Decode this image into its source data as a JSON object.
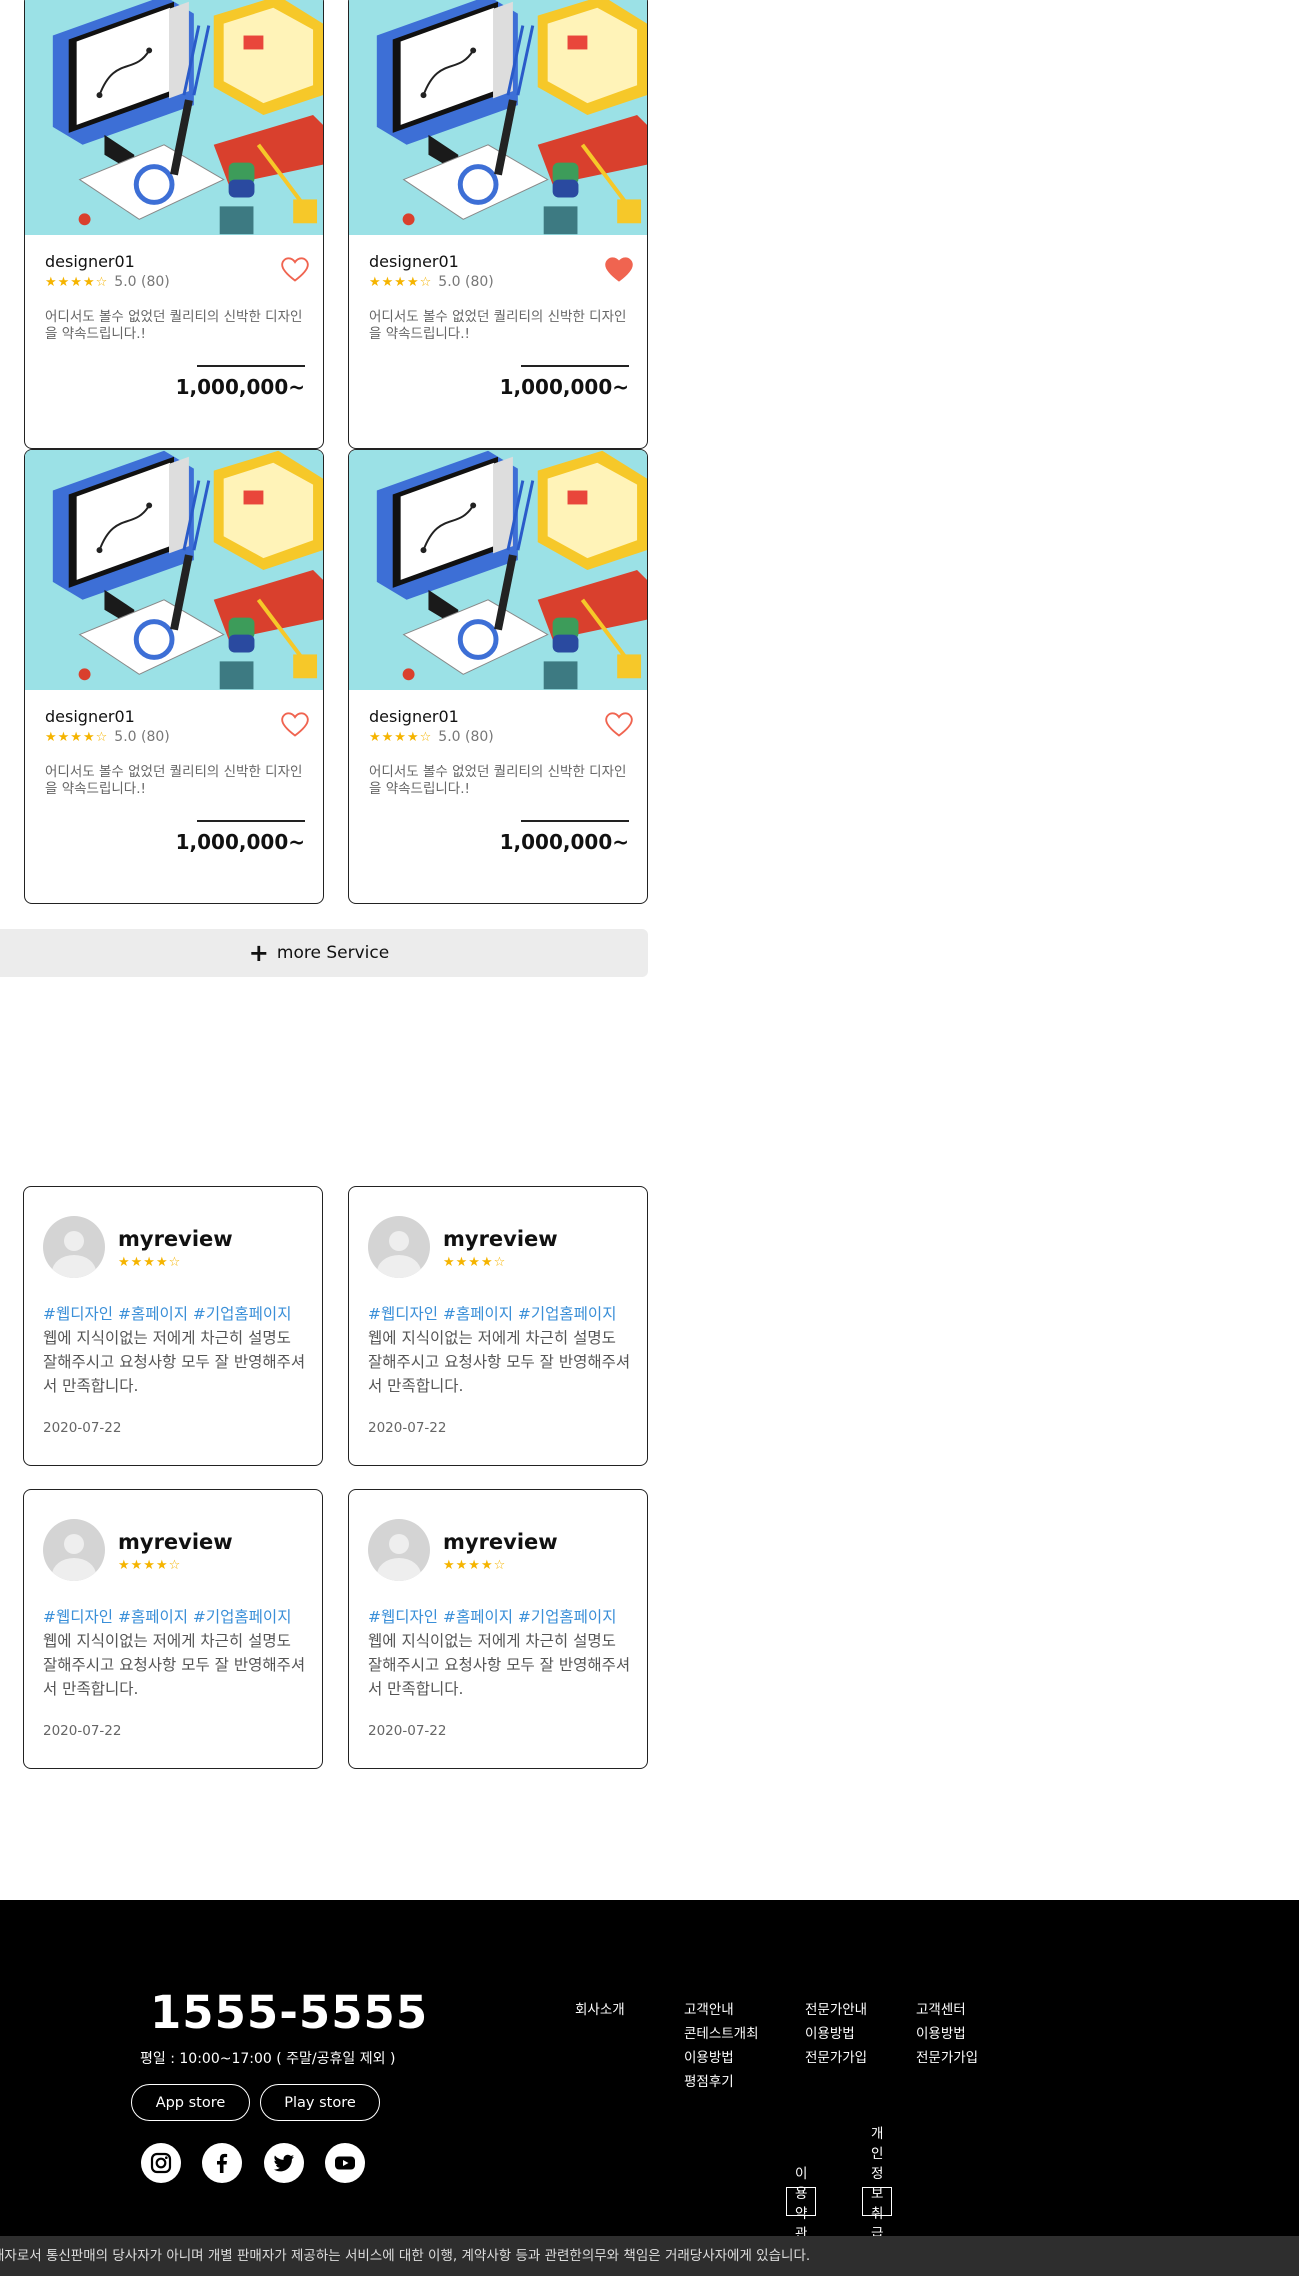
{
  "services": [
    {
      "name": "designer01",
      "stars": "★★★★☆",
      "rating": "5.0 (80)",
      "desc": "어디서도 볼수 없었던 퀄리티의 신박한 디자인을 약속드립니다.!",
      "price": "1,000,000~",
      "liked": false
    },
    {
      "name": "designer01",
      "stars": "★★★★☆",
      "rating": "5.0 (80)",
      "desc": "어디서도 볼수 없었던 퀄리티의 신박한 디자인을 약속드립니다.!",
      "price": "1,000,000~",
      "liked": true
    },
    {
      "name": "designer01",
      "stars": "★★★★☆",
      "rating": "5.0 (80)",
      "desc": "어디서도 볼수 없었던 퀄리티의 신박한 디자인을 약속드립니다.!",
      "price": "1,000,000~",
      "liked": false
    },
    {
      "name": "designer01",
      "stars": "★★★★☆",
      "rating": "5.0 (80)",
      "desc": "어디서도 볼수 없었던 퀄리티의 신박한 디자인을 약속드립니다.!",
      "price": "1,000,000~",
      "liked": false
    }
  ],
  "more_button": {
    "icon": "plus-icon",
    "label": "more Service"
  },
  "reviews": [
    {
      "name": "myreview",
      "stars": "★★★★☆",
      "tags": "#웹디자인 #홈페이지 #기업홈페이지",
      "text": "웹에 지식이없는 저에게 차근히 설명도 잘해주시고 요청사항 모두 잘 반영해주셔서 만족합니다.",
      "date": "2020-07-22"
    },
    {
      "name": "myreview",
      "stars": "★★★★☆",
      "tags": "#웹디자인 #홈페이지 #기업홈페이지",
      "text": "웹에 지식이없는 저에게 차근히 설명도 잘해주시고 요청사항 모두 잘 반영해주셔서 만족합니다.",
      "date": "2020-07-22"
    },
    {
      "name": "myreview",
      "stars": "★★★★☆",
      "tags": "#웹디자인 #홈페이지 #기업홈페이지",
      "text": "웹에 지식이없는 저에게 차근히 설명도 잘해주시고 요청사항 모두 잘 반영해주셔서 만족합니다.",
      "date": "2020-07-22"
    },
    {
      "name": "myreview",
      "stars": "★★★★☆",
      "tags": "#웹디자인 #홈페이지 #기업홈페이지",
      "text": "웹에 지식이없는 저에게 차근히 설명도 잘해주시고 요청사항 모두 잘 반영해주셔서 만족합니다.",
      "date": "2020-07-22"
    }
  ],
  "footer": {
    "phone": "1555-5555",
    "hours": "평일 : 10:00~17:00 ( 주말/공휴일 제외 )",
    "app_store": "App store",
    "play_store": "Play store",
    "social": [
      "instagram-icon",
      "facebook-icon",
      "twitter-icon",
      "youtube-icon"
    ],
    "col1": [
      "회사소개"
    ],
    "col2": [
      "고객안내",
      "콘테스트개최",
      "이용방법",
      "평점후기"
    ],
    "col3": [
      "전문가안내",
      "이용방법",
      "전문가가입"
    ],
    "col4": [
      "고객센터",
      "이용방법",
      "전문가가입"
    ],
    "terms": "이용약관",
    "privacy": "개인정보취급방침",
    "disclaimer": "재자로서 통신판매의 당사자가 아니며 개별 판매자가 제공하는 서비스에 대한 이행, 계약사항 등과 관련한의무와 책임은 거래당사자에게 있습니다."
  },
  "colors": {
    "accent_heart": "#f06450",
    "star": "#f5b400",
    "tag": "#3a8fd8",
    "thumb_bg": "#9be1e6"
  }
}
